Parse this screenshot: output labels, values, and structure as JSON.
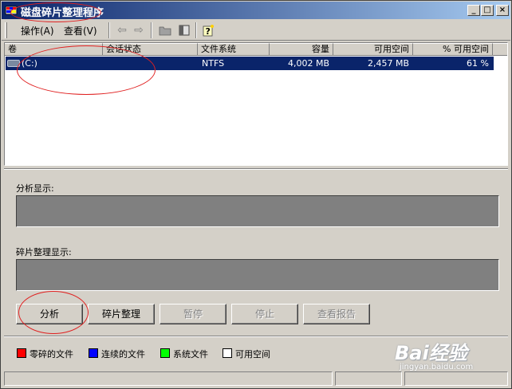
{
  "window": {
    "title": "磁盘碎片整理程序",
    "buttons": {
      "minimize": "_",
      "maximize": "□",
      "close": "×"
    }
  },
  "menu": {
    "items": [
      {
        "label": "操作(A)"
      },
      {
        "label": "查看(V)"
      }
    ]
  },
  "toolbar": {
    "icons": [
      "back-arrow-icon",
      "forward-arrow-icon",
      "folder-icon",
      "properties-icon",
      "help-icon"
    ]
  },
  "volume_list": {
    "columns": [
      "卷",
      "会话状态",
      "文件系统",
      "容量",
      "可用空间",
      "% 可用空间"
    ],
    "rows": [
      {
        "volume": "(C:)",
        "session_status": "",
        "file_system": "NTFS",
        "capacity": "4,002 MB",
        "free_space": "2,457 MB",
        "percent_free": "61 %"
      }
    ]
  },
  "analysis": {
    "label": "分析显示:"
  },
  "defrag": {
    "label": "碎片整理显示:"
  },
  "actions": {
    "analyze": "分析",
    "defragment": "碎片整理",
    "pause": "暂停",
    "stop": "停止",
    "view_report": "查看报告"
  },
  "legend": [
    {
      "label": "零碎的文件",
      "color": "#ff0000"
    },
    {
      "label": "连续的文件",
      "color": "#0000ff"
    },
    {
      "label": "系统文件",
      "color": "#00ff00"
    },
    {
      "label": "可用空间",
      "color": "#ffffff"
    }
  ],
  "watermark": {
    "brand": "Bai经验",
    "url": "jingyan.baidu.com"
  }
}
